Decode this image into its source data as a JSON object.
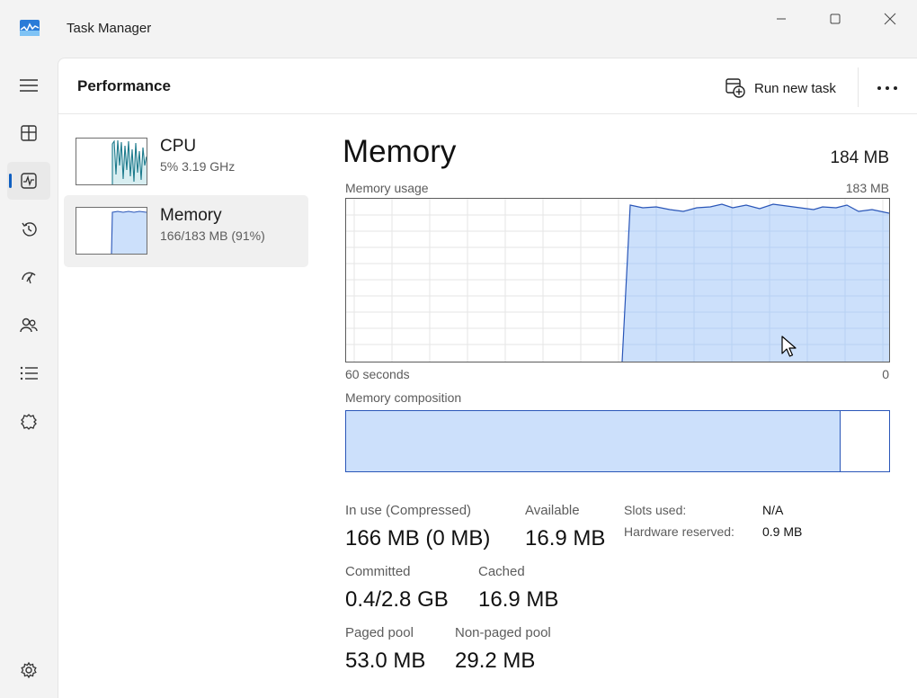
{
  "window": {
    "title": "Task Manager",
    "controls": [
      "minimize",
      "maximize",
      "close"
    ]
  },
  "nav": {
    "items": [
      {
        "name": "hamburger",
        "icon": "menu-icon"
      },
      {
        "name": "processes",
        "icon": "processes-icon"
      },
      {
        "name": "performance",
        "icon": "performance-icon",
        "active": true
      },
      {
        "name": "app-history",
        "icon": "history-icon"
      },
      {
        "name": "startup-apps",
        "icon": "startup-icon"
      },
      {
        "name": "users",
        "icon": "users-icon"
      },
      {
        "name": "details",
        "icon": "details-icon"
      },
      {
        "name": "services",
        "icon": "services-icon"
      },
      {
        "name": "settings",
        "icon": "gear-icon"
      }
    ],
    "accent": "#0f5fc1"
  },
  "header": {
    "title": "Performance",
    "run_new_task": "Run new task"
  },
  "resources": [
    {
      "name": "CPU",
      "sub": "5%  3.19 GHz"
    },
    {
      "name": "Memory",
      "sub": "166/183 MB (91%)"
    }
  ],
  "memory": {
    "title": "Memory",
    "total": "184 MB",
    "usage_label": "Memory usage",
    "usage_max": "183 MB",
    "time_left": "60 seconds",
    "time_right": "0",
    "composition_label": "Memory composition",
    "in_use_fraction": 0.91,
    "stats": {
      "in_use_label": "In use (Compressed)",
      "in_use_value": "166 MB (0 MB)",
      "available_label": "Available",
      "available_value": "16.9 MB",
      "committed_label": "Committed",
      "committed_value": "0.4/2.8 GB",
      "cached_label": "Cached",
      "cached_value": "16.9 MB",
      "paged_label": "Paged pool",
      "paged_value": "53.0 MB",
      "nonpaged_label": "Non-paged pool",
      "nonpaged_value": "29.2 MB"
    },
    "hardware": {
      "slots_label": "Slots used:",
      "slots_value": "N/A",
      "reserved_label": "Hardware reserved:",
      "reserved_value": "0.9 MB"
    }
  },
  "colors": {
    "memory_fill": "#cce0fb",
    "memory_line": "#2a56b8",
    "cpu_line": "#1c7a8c",
    "cpu_fill": "#d8eef1"
  }
}
